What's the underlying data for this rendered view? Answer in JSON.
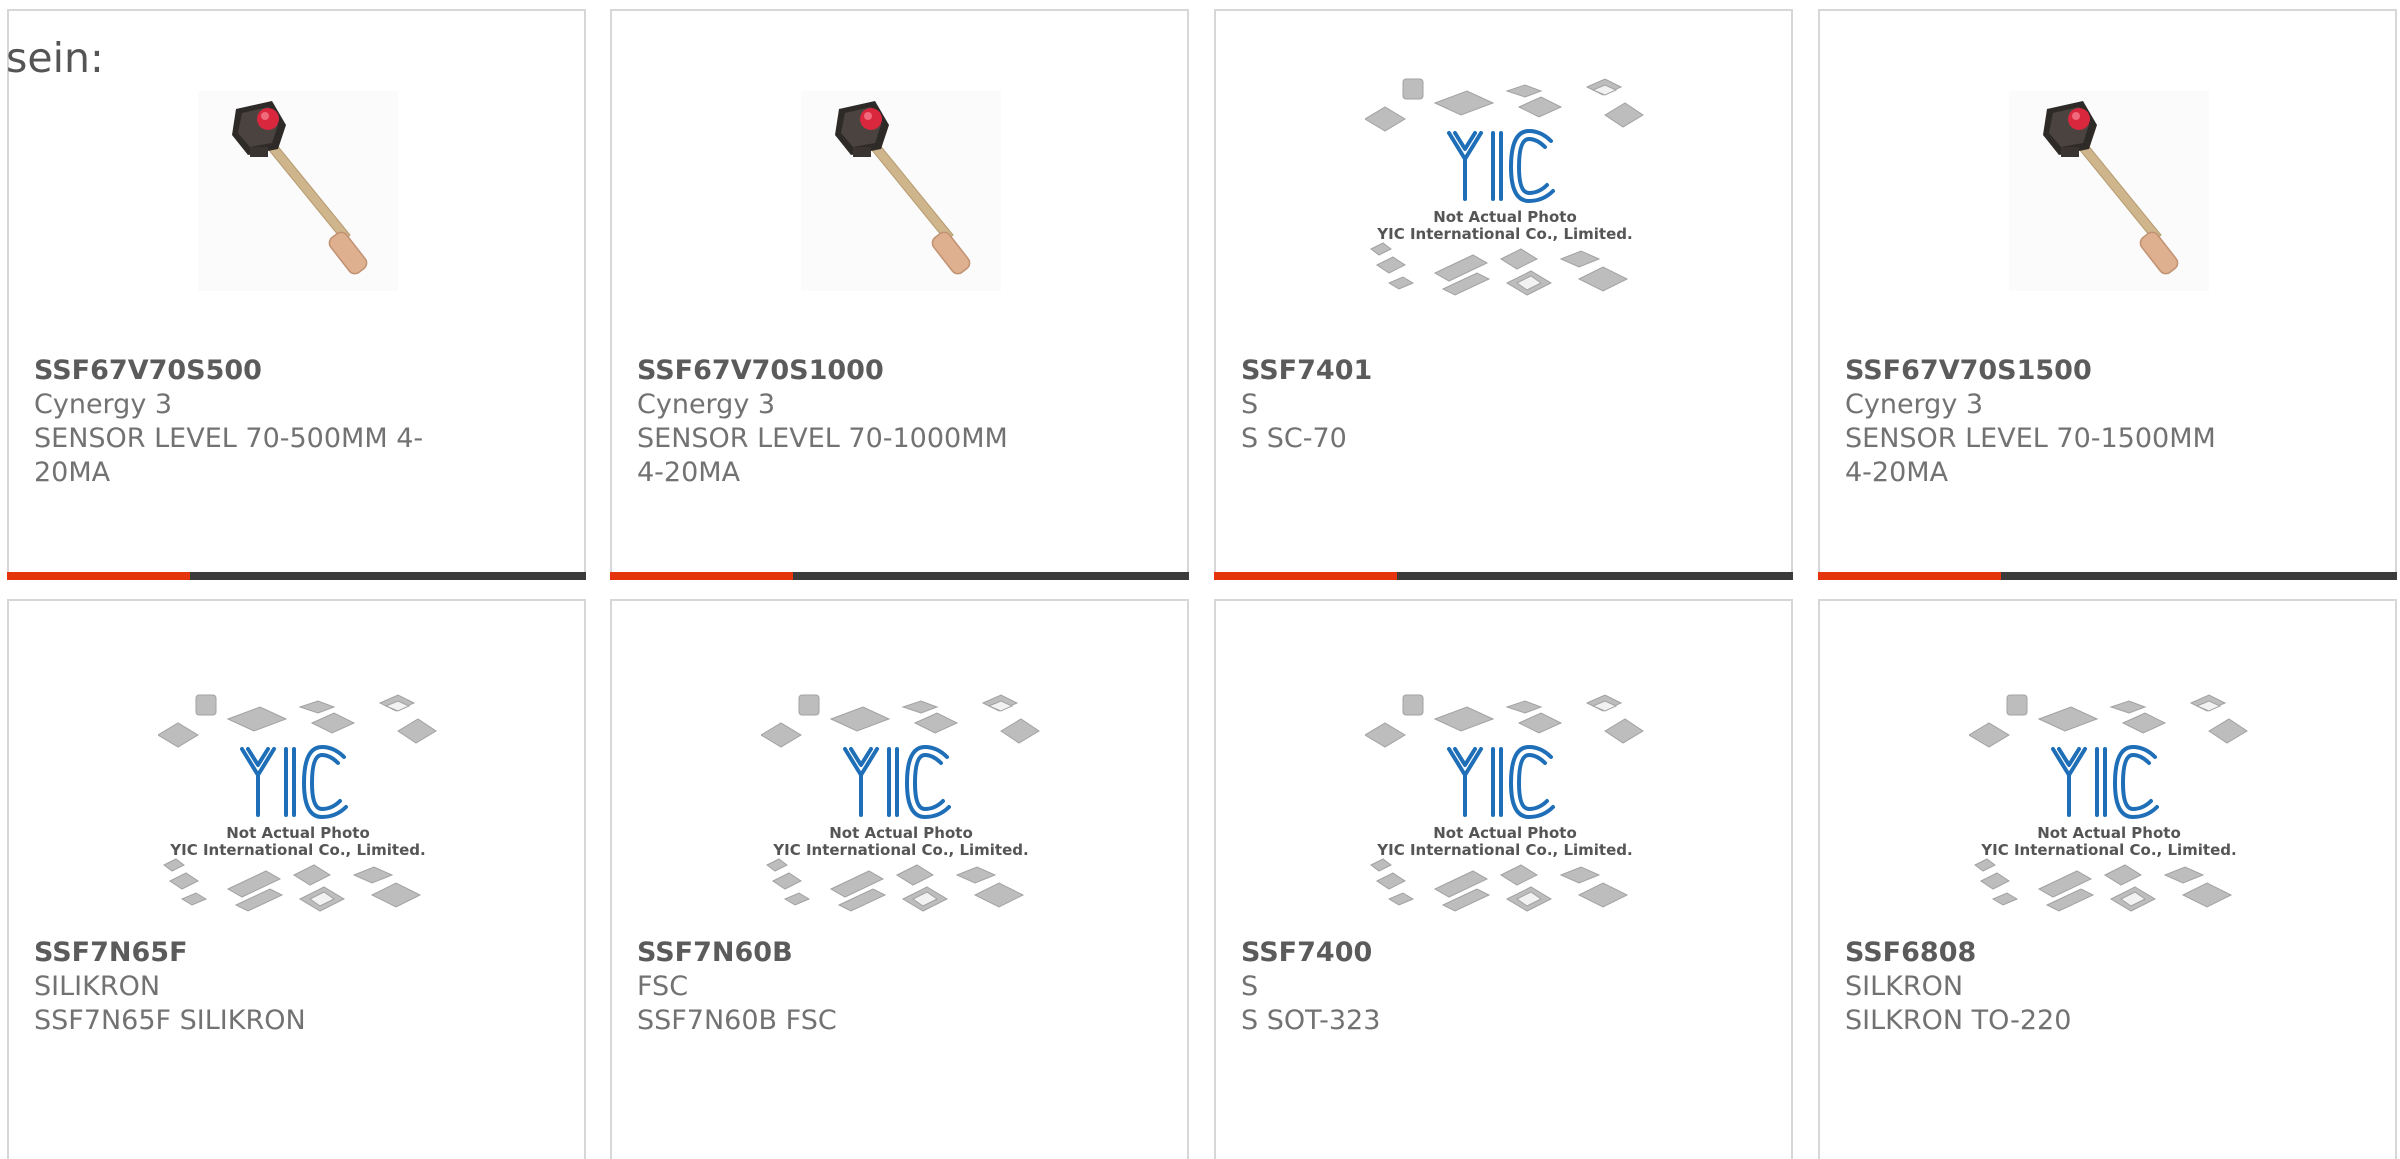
{
  "lead_text": "sein:",
  "placeholder_caption": {
    "line1": "Not Actual Photo",
    "line2": "YIC International Co., Limited.",
    "logo": "YIC"
  },
  "products": [
    {
      "part": "SSF67V70S500",
      "maker": "Cynergy 3",
      "desc": "SENSOR LEVEL 70-500MM 4-20MA",
      "image": "level-sensor-probe"
    },
    {
      "part": "SSF67V70S1000",
      "maker": "Cynergy 3",
      "desc": "SENSOR LEVEL 70-1000MM 4-20MA",
      "image": "level-sensor-probe"
    },
    {
      "part": "SSF7401",
      "maker": "S",
      "desc": "S SC-70",
      "image": "yic-placeholder"
    },
    {
      "part": "SSF67V70S1500",
      "maker": "Cynergy 3",
      "desc": "SENSOR LEVEL 70-1500MM 4-20MA",
      "image": "level-sensor-probe"
    },
    {
      "part": "SSF7N65F",
      "maker": "SILIKRON",
      "desc": "SSF7N65F SILIKRON",
      "image": "yic-placeholder"
    },
    {
      "part": "SSF7N60B",
      "maker": "FSC",
      "desc": "SSF7N60B FSC",
      "image": "yic-placeholder"
    },
    {
      "part": "SSF7400",
      "maker": "S",
      "desc": "S SOT-323",
      "image": "yic-placeholder"
    },
    {
      "part": "SSF6808",
      "maker": "SILKRON",
      "desc": "SILKRON TO-220",
      "image": "yic-placeholder"
    }
  ],
  "colors": {
    "accent": "#e5350d",
    "bar": "#3b3b3b",
    "border": "#d7d7d7",
    "logo_blue": "#1f6fb8"
  }
}
